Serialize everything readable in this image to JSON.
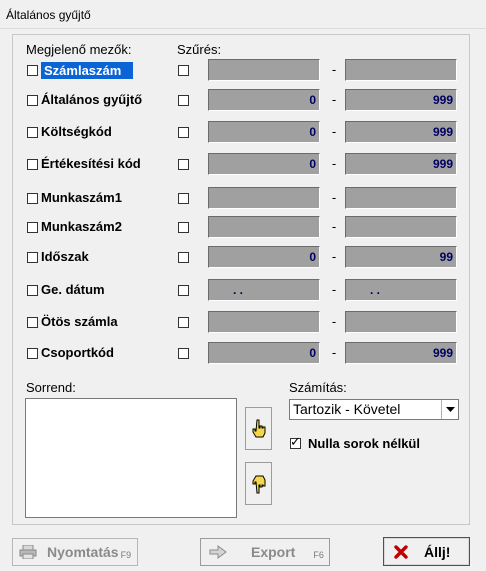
{
  "window": {
    "title": "Általános gyűjtő"
  },
  "labels": {
    "fields_header": "Megjelenő mezők:",
    "filter_header": "Szűrés:",
    "range_separator": "-",
    "order_header": "Sorrend:",
    "calc_header": "Számítás:"
  },
  "rows": [
    {
      "label": "Számlaszám",
      "from": "",
      "to": ""
    },
    {
      "label": "Általános gyűjtő",
      "from": "0",
      "to": "999"
    },
    {
      "label": "Költségkód",
      "from": "0",
      "to": "999"
    },
    {
      "label": "Értékesítési kód",
      "from": "0",
      "to": "999"
    },
    {
      "label": "Munkaszám1",
      "from": "",
      "to": ""
    },
    {
      "label": "Munkaszám2",
      "from": "",
      "to": ""
    },
    {
      "label": "Időszak",
      "from": "0",
      "to": "99"
    },
    {
      "label": "Ge. dátum",
      "from": ".     .",
      "to": ".     ."
    },
    {
      "label": "Ötös számla",
      "from": "",
      "to": ""
    },
    {
      "label": "Csoportkód",
      "from": "0",
      "to": "999"
    }
  ],
  "calc": {
    "selected": "Tartozik - Követel",
    "zero_rows_label": "Nulla sorok nélkül",
    "zero_rows_checked": true
  },
  "buttons": {
    "print_label": "Nyomtatás",
    "print_key": "F9",
    "export_label": "Export",
    "export_key": "F6",
    "stop_label": "Állj!"
  },
  "icons": {
    "move_up": "hand-point-up-icon",
    "move_down": "hand-point-down-icon",
    "print": "printer-icon",
    "export": "export-arrow-icon",
    "stop": "red-x-icon"
  },
  "colors": {
    "selection": "#0a64d6",
    "field_bg": "#a0a0a0",
    "field_text": "#000060",
    "stop_icon": "#c00000"
  }
}
